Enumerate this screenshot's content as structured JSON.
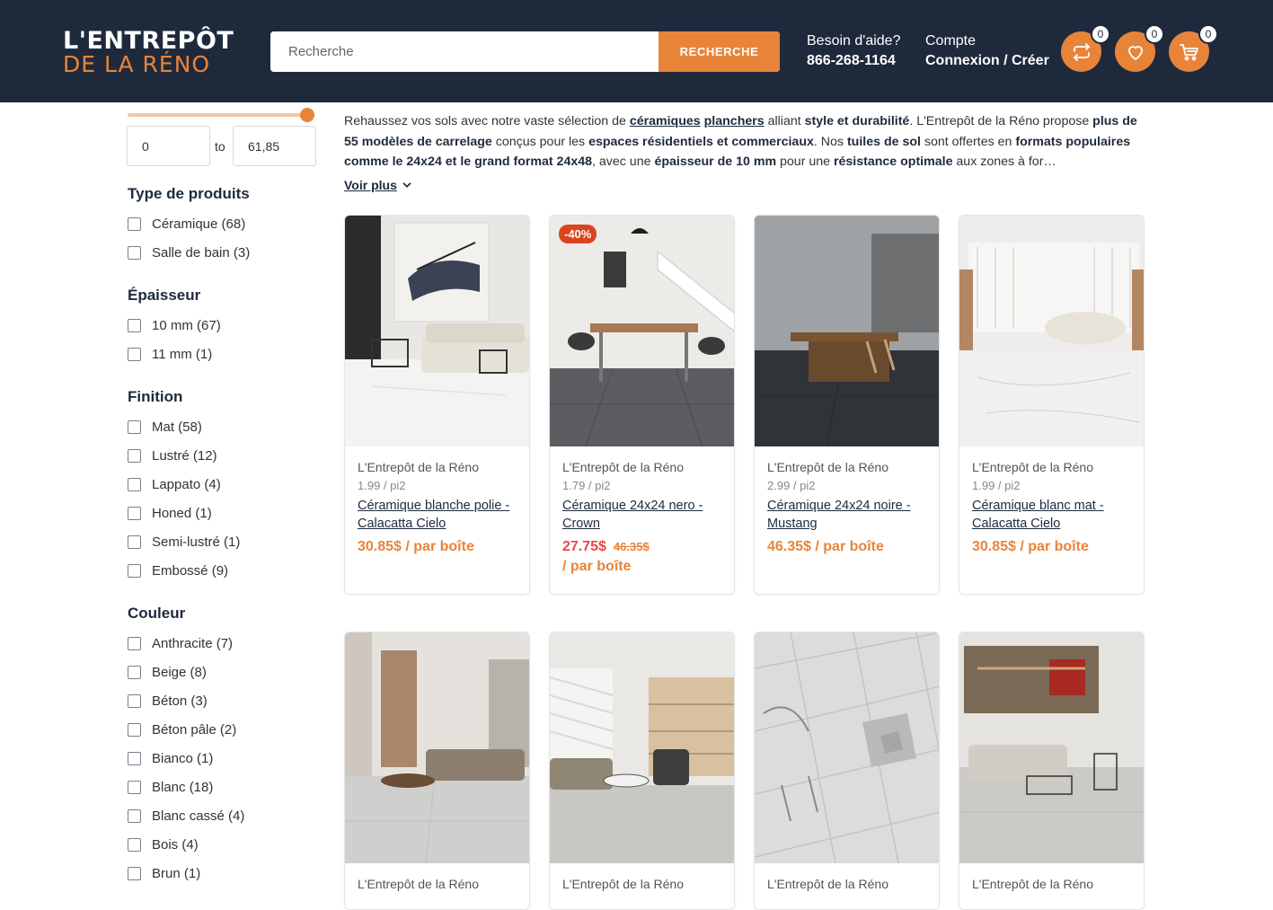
{
  "header": {
    "logo_line1": "L'ENTREPÔT",
    "logo_line2": "DE LA RÉNO",
    "search_placeholder": "Recherche",
    "search_button": "RECHERCHE",
    "help_label": "Besoin d'aide?",
    "help_phone": "866-268-1164",
    "account_label": "Compte",
    "account_links": "Connexion / Créer",
    "compare_count": "0",
    "wishlist_count": "0",
    "cart_count": "0",
    "accent_color": "#e8843a",
    "bg_color": "#1e2a3c"
  },
  "price_filter": {
    "min": "0",
    "to": "to",
    "max": "61,85"
  },
  "facets": [
    {
      "title": "Type de produits",
      "items": [
        "Céramique (68)",
        "Salle de bain (3)"
      ]
    },
    {
      "title": "Épaisseur",
      "items": [
        "10 mm (67)",
        "11 mm (1)"
      ]
    },
    {
      "title": "Finition",
      "items": [
        "Mat (58)",
        "Lustré (12)",
        "Lappato (4)",
        "Honed (1)",
        "Semi-lustré (1)",
        "Embossé (9)"
      ]
    },
    {
      "title": "Couleur",
      "items": [
        "Anthracite (7)",
        "Beige (8)",
        "Béton (3)",
        "Béton pâle (2)",
        "Bianco (1)",
        "Blanc (18)",
        "Blanc cassé (4)",
        "Bois (4)",
        "Brun (1)"
      ]
    }
  ],
  "intro": {
    "t1": "Rehaussez vos sols avec notre vaste sélection de ",
    "t2": "céramiques",
    "t3": " ",
    "t4": "planchers",
    "t5": " alliant ",
    "t6": "style et durabilité",
    "t7": ". L'Entrepôt de la Réno propose ",
    "t8": "plus de 55 modèles de carrelage",
    "t9": " conçus pour les ",
    "t10": "espaces résidentiels et commerciaux",
    "t11": ". Nos ",
    "t12": "tuiles de sol",
    "t13": " sont offertes en ",
    "t14": "formats populaires comme le 24x24 et le grand format 24x48",
    "t15": ", avec une ",
    "t16": "épaisseur de 10 mm",
    "t17": " pour une ",
    "t18": "résistance optimale",
    "t19": " aux zones à for…",
    "voir_plus": "Voir plus"
  },
  "products": [
    {
      "brand": "L'Entrepôt de la Réno",
      "unit": "1.99 / pi2",
      "name": "Céramique blanche polie - Calacatta Cielo",
      "price": "30.85$ / par boîte",
      "old_price": "",
      "per": "",
      "badge": ""
    },
    {
      "brand": "L'Entrepôt de la Réno",
      "unit": "1.79 / pi2",
      "name": "Céramique 24x24 nero - Crown",
      "price": "27.75$",
      "old_price": "46.35$",
      "per": "/ par boîte",
      "badge": "-40%"
    },
    {
      "brand": "L'Entrepôt de la Réno",
      "unit": "2.99 / pi2",
      "name": "Céramique 24x24 noire - Mustang",
      "price": "46.35$ / par boîte",
      "old_price": "",
      "per": "",
      "badge": ""
    },
    {
      "brand": "L'Entrepôt de la Réno",
      "unit": "1.99 / pi2",
      "name": "Céramique blanc mat - Calacatta Cielo",
      "price": "30.85$ / par boîte",
      "old_price": "",
      "per": "",
      "badge": ""
    },
    {
      "brand": "L'Entrepôt de la Réno",
      "unit": "",
      "name": "",
      "price": "",
      "old_price": "",
      "per": "",
      "badge": ""
    },
    {
      "brand": "L'Entrepôt de la Réno",
      "unit": "",
      "name": "",
      "price": "",
      "old_price": "",
      "per": "",
      "badge": ""
    },
    {
      "brand": "L'Entrepôt de la Réno",
      "unit": "",
      "name": "",
      "price": "",
      "old_price": "",
      "per": "",
      "badge": ""
    },
    {
      "brand": "L'Entrepôt de la Réno",
      "unit": "",
      "name": "",
      "price": "",
      "old_price": "",
      "per": "",
      "badge": ""
    }
  ]
}
